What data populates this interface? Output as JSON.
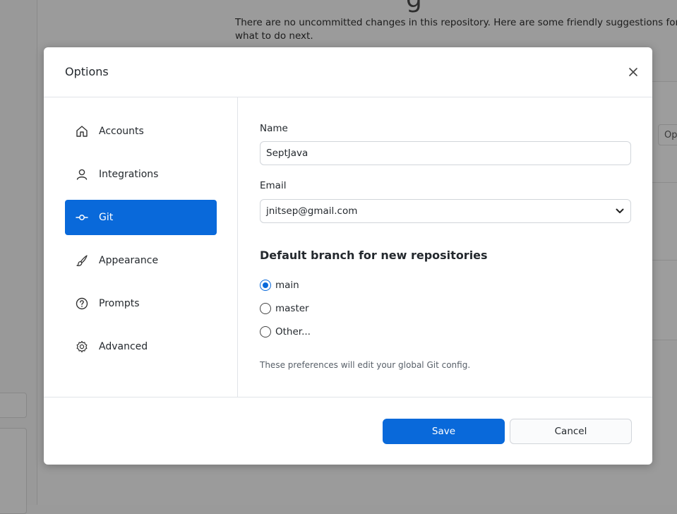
{
  "background": {
    "title_fragment": "g",
    "message": "There are no uncommitted changes in this repository. Here are some friendly suggestions for what to do next.",
    "right_button_label": "Op"
  },
  "dialog": {
    "title": "Options",
    "close_icon": "close-icon"
  },
  "sidebar": {
    "items": [
      {
        "label": "Accounts",
        "icon": "home-icon",
        "selected": false
      },
      {
        "label": "Integrations",
        "icon": "person-icon",
        "selected": false
      },
      {
        "label": "Git",
        "icon": "git-commit-icon",
        "selected": true
      },
      {
        "label": "Appearance",
        "icon": "paintbrush-icon",
        "selected": false
      },
      {
        "label": "Prompts",
        "icon": "question-icon",
        "selected": false
      },
      {
        "label": "Advanced",
        "icon": "gear-icon",
        "selected": false
      }
    ]
  },
  "git": {
    "name_label": "Name",
    "name_value": "SeptJava",
    "email_label": "Email",
    "email_value": "jnitsep@gmail.com",
    "default_branch_heading": "Default branch for new repositories",
    "branch_options": [
      {
        "label": "main",
        "checked": true
      },
      {
        "label": "master",
        "checked": false
      },
      {
        "label": "Other...",
        "checked": false
      }
    ],
    "hint": "These preferences will edit your global Git config."
  },
  "footer": {
    "save_label": "Save",
    "cancel_label": "Cancel"
  },
  "colors": {
    "accent": "#0969da",
    "overlay": "#9b9b9b"
  }
}
